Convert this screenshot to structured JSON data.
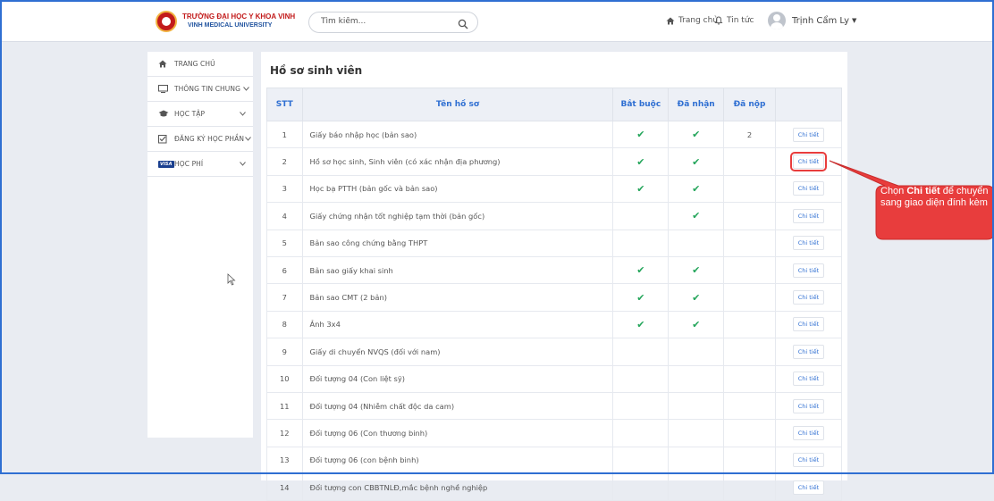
{
  "header": {
    "brand_name": "TRƯỜNG ĐẠI HỌC Y KHOA VINH",
    "brand_sub": "VINH MEDICAL UNIVERSITY",
    "search_placeholder": "Tìm kiếm...",
    "nav_home": "Trang chủ",
    "nav_news": "Tin tức",
    "user_name": "Trịnh Cẩm Ly"
  },
  "sidebar": {
    "items": [
      {
        "label": "TRANG CHỦ",
        "icon": "home-icon"
      },
      {
        "label": "THÔNG TIN CHUNG",
        "icon": "monitor-icon"
      },
      {
        "label": "HỌC TẬP",
        "icon": "graduation-cap-icon"
      },
      {
        "label": "ĐĂNG KÝ HỌC PHẦN",
        "icon": "checkbox-icon"
      },
      {
        "label": "HỌC PHÍ",
        "icon": "visa-card-icon",
        "badge": "VISA"
      }
    ]
  },
  "main": {
    "title": "Hồ sơ sinh viên",
    "columns": [
      "STT",
      "Tên hồ sơ",
      "Bắt buộc",
      "Đã nhận",
      "Đã nộp",
      ""
    ],
    "detail_label": "Chi tiết",
    "rows": [
      {
        "stt": "1",
        "name": "Giấy báo nhập học (bản sao)",
        "required": true,
        "received": true,
        "submitted": "2"
      },
      {
        "stt": "2",
        "name": "Hồ sơ học sinh, Sinh viên (có xác nhận địa phương)",
        "required": true,
        "received": true,
        "submitted": ""
      },
      {
        "stt": "3",
        "name": "Học bạ PTTH (bản gốc và bản sao)",
        "required": true,
        "received": true,
        "submitted": ""
      },
      {
        "stt": "4",
        "name": "Giấy chứng nhận tốt nghiệp tạm thời (bản gốc)",
        "required": false,
        "received": true,
        "submitted": ""
      },
      {
        "stt": "5",
        "name": "Bản sao công chứng bằng THPT",
        "required": false,
        "received": false,
        "submitted": ""
      },
      {
        "stt": "6",
        "name": "Bản sao giấy khai sinh",
        "required": true,
        "received": true,
        "submitted": ""
      },
      {
        "stt": "7",
        "name": "Bản sao CMT (2 bản)",
        "required": true,
        "received": true,
        "submitted": ""
      },
      {
        "stt": "8",
        "name": "Ảnh 3x4",
        "required": true,
        "received": true,
        "submitted": ""
      },
      {
        "stt": "9",
        "name": "Giấy di chuyển NVQS (đối với nam)",
        "required": false,
        "received": false,
        "submitted": ""
      },
      {
        "stt": "10",
        "name": "Đối tượng 04 (Con liệt sỹ)",
        "required": false,
        "received": false,
        "submitted": ""
      },
      {
        "stt": "11",
        "name": "Đối tượng 04 (Nhiễm chất độc da cam)",
        "required": false,
        "received": false,
        "submitted": ""
      },
      {
        "stt": "12",
        "name": "Đối tượng 06 (Con thương binh)",
        "required": false,
        "received": false,
        "submitted": ""
      },
      {
        "stt": "13",
        "name": "Đối tượng 06 (con bệnh binh)",
        "required": false,
        "received": false,
        "submitted": ""
      },
      {
        "stt": "14",
        "name": "Đối tượng con CBBTNLĐ,mắc bệnh nghề nghiệp",
        "required": false,
        "received": false,
        "submitted": ""
      }
    ]
  },
  "callout": {
    "prefix": "Chọn ",
    "bold": "Chi tiết",
    "suffix": " để chuyển sang giao diện đính kèm",
    "color": "#e83d3d"
  },
  "colors": {
    "accent": "#2f6fd2",
    "check": "#23a55a",
    "brand_red": "#c21b1b"
  }
}
